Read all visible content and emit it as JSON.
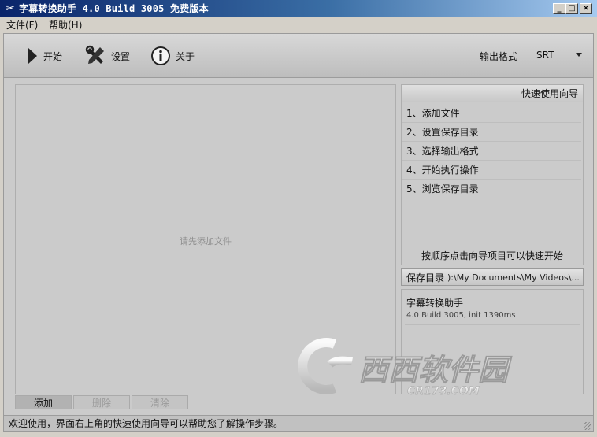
{
  "window": {
    "title": "字幕转换助手 4.0 Build 3005 免费版本",
    "min_label": "_",
    "max_label": "□",
    "close_label": "×"
  },
  "menu": {
    "items": [
      {
        "label": "文件(F)"
      },
      {
        "label": "帮助(H)"
      }
    ]
  },
  "toolbar": {
    "start_label": "开始",
    "settings_label": "设置",
    "about_label": "关于",
    "output_format_label": "输出格式",
    "output_format_value": "SRT"
  },
  "file_list": {
    "placeholder": "请先添加文件"
  },
  "bottom_tabs": {
    "add": "添加",
    "delete": "删除",
    "clear": "清除"
  },
  "guide": {
    "header": "快速使用向导",
    "items": [
      {
        "label": "1、添加文件"
      },
      {
        "label": "2、设置保存目录"
      },
      {
        "label": "3、选择输出格式"
      },
      {
        "label": "4、开始执行操作"
      },
      {
        "label": "5、浏览保存目录"
      }
    ],
    "footer": "按顺序点击向导项目可以快速开始"
  },
  "save": {
    "label": "保存目录",
    "path": "):\\My Documents\\My Videos\\..."
  },
  "info": {
    "title": "字幕转换助手",
    "subtitle": "4.0 Build 3005, init 1390ms"
  },
  "watermark": {
    "text_cn": "西西软件园",
    "text_en": "CR173.COM"
  },
  "status": {
    "text": "欢迎使用，界面右上角的快速使用向导可以帮助您了解操作步骤。"
  },
  "colors": {
    "titlebar_start": "#0a246a",
    "titlebar_end": "#a6caf0",
    "panel": "#cbcbcb"
  }
}
